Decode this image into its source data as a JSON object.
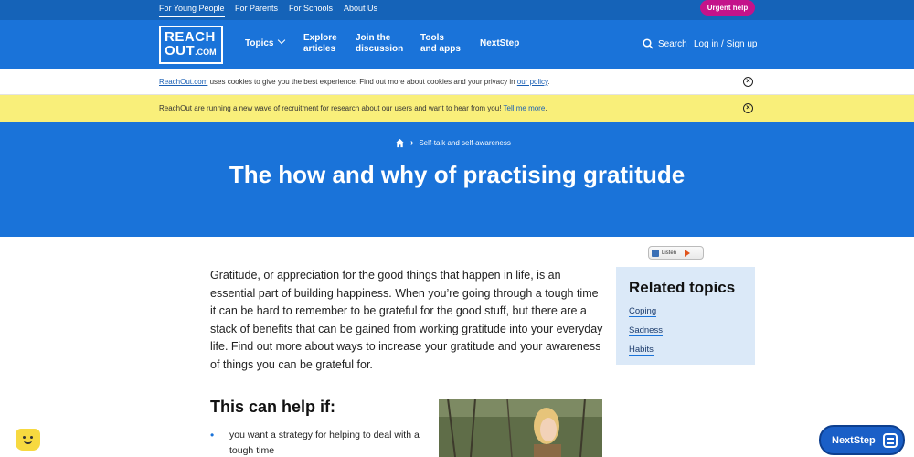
{
  "topbar": {
    "audiences": [
      "For Young People",
      "For Parents",
      "For Schools",
      "About Us"
    ],
    "urgent_help": "Urgent help"
  },
  "nav": {
    "logo_line1": "REACH",
    "logo_line2": "OUT",
    "logo_suffix": ".COM",
    "topics": "Topics",
    "explore_line1": "Explore",
    "explore_line2": "articles",
    "join_line1": "Join the",
    "join_line2": "discussion",
    "tools_line1": "Tools",
    "tools_line2": "and apps",
    "nextstep": "NextStep",
    "search": "Search",
    "login": "Log in / Sign up"
  },
  "cookie_banner": {
    "site": "ReachOut.com",
    "text": " uses cookies to give you the best experience. Find out more about cookies and your privacy in ",
    "link": "our policy",
    "end": "."
  },
  "recruit_banner": {
    "text": "ReachOut are running a new wave of recruitment for research about our users and want to hear from you! ",
    "link": "Tell me more",
    "end": "."
  },
  "hero": {
    "breadcrumb": "Self-talk and self-awareness",
    "title": "The how and why of practising gratitude"
  },
  "listen_label": "Listen",
  "article": {
    "intro": "Gratitude, or appreciation for the good things that happen in life, is an essential part of building happiness. When you’re going through a tough time it can be hard to remember to be grateful for the good stuff, but there are a stack of benefits that can be gained from working gratitude into your everyday life. Find out more about ways to increase your gratitude and your awareness of things you can be grateful for.",
    "help_heading": "This can help if:",
    "bullet1": "you want a strategy for helping to deal with a tough time"
  },
  "related": {
    "title": "Related topics",
    "links": [
      "Coping",
      "Sadness",
      "Habits"
    ]
  },
  "nextstep_button": "NextStep",
  "colors": {
    "brand_blue": "#1a73d9",
    "topbar_blue": "#1563b8",
    "urgent_pink": "#c4138a",
    "banner_yellow": "#f9ef7a",
    "related_bg": "#dbe9f8"
  }
}
